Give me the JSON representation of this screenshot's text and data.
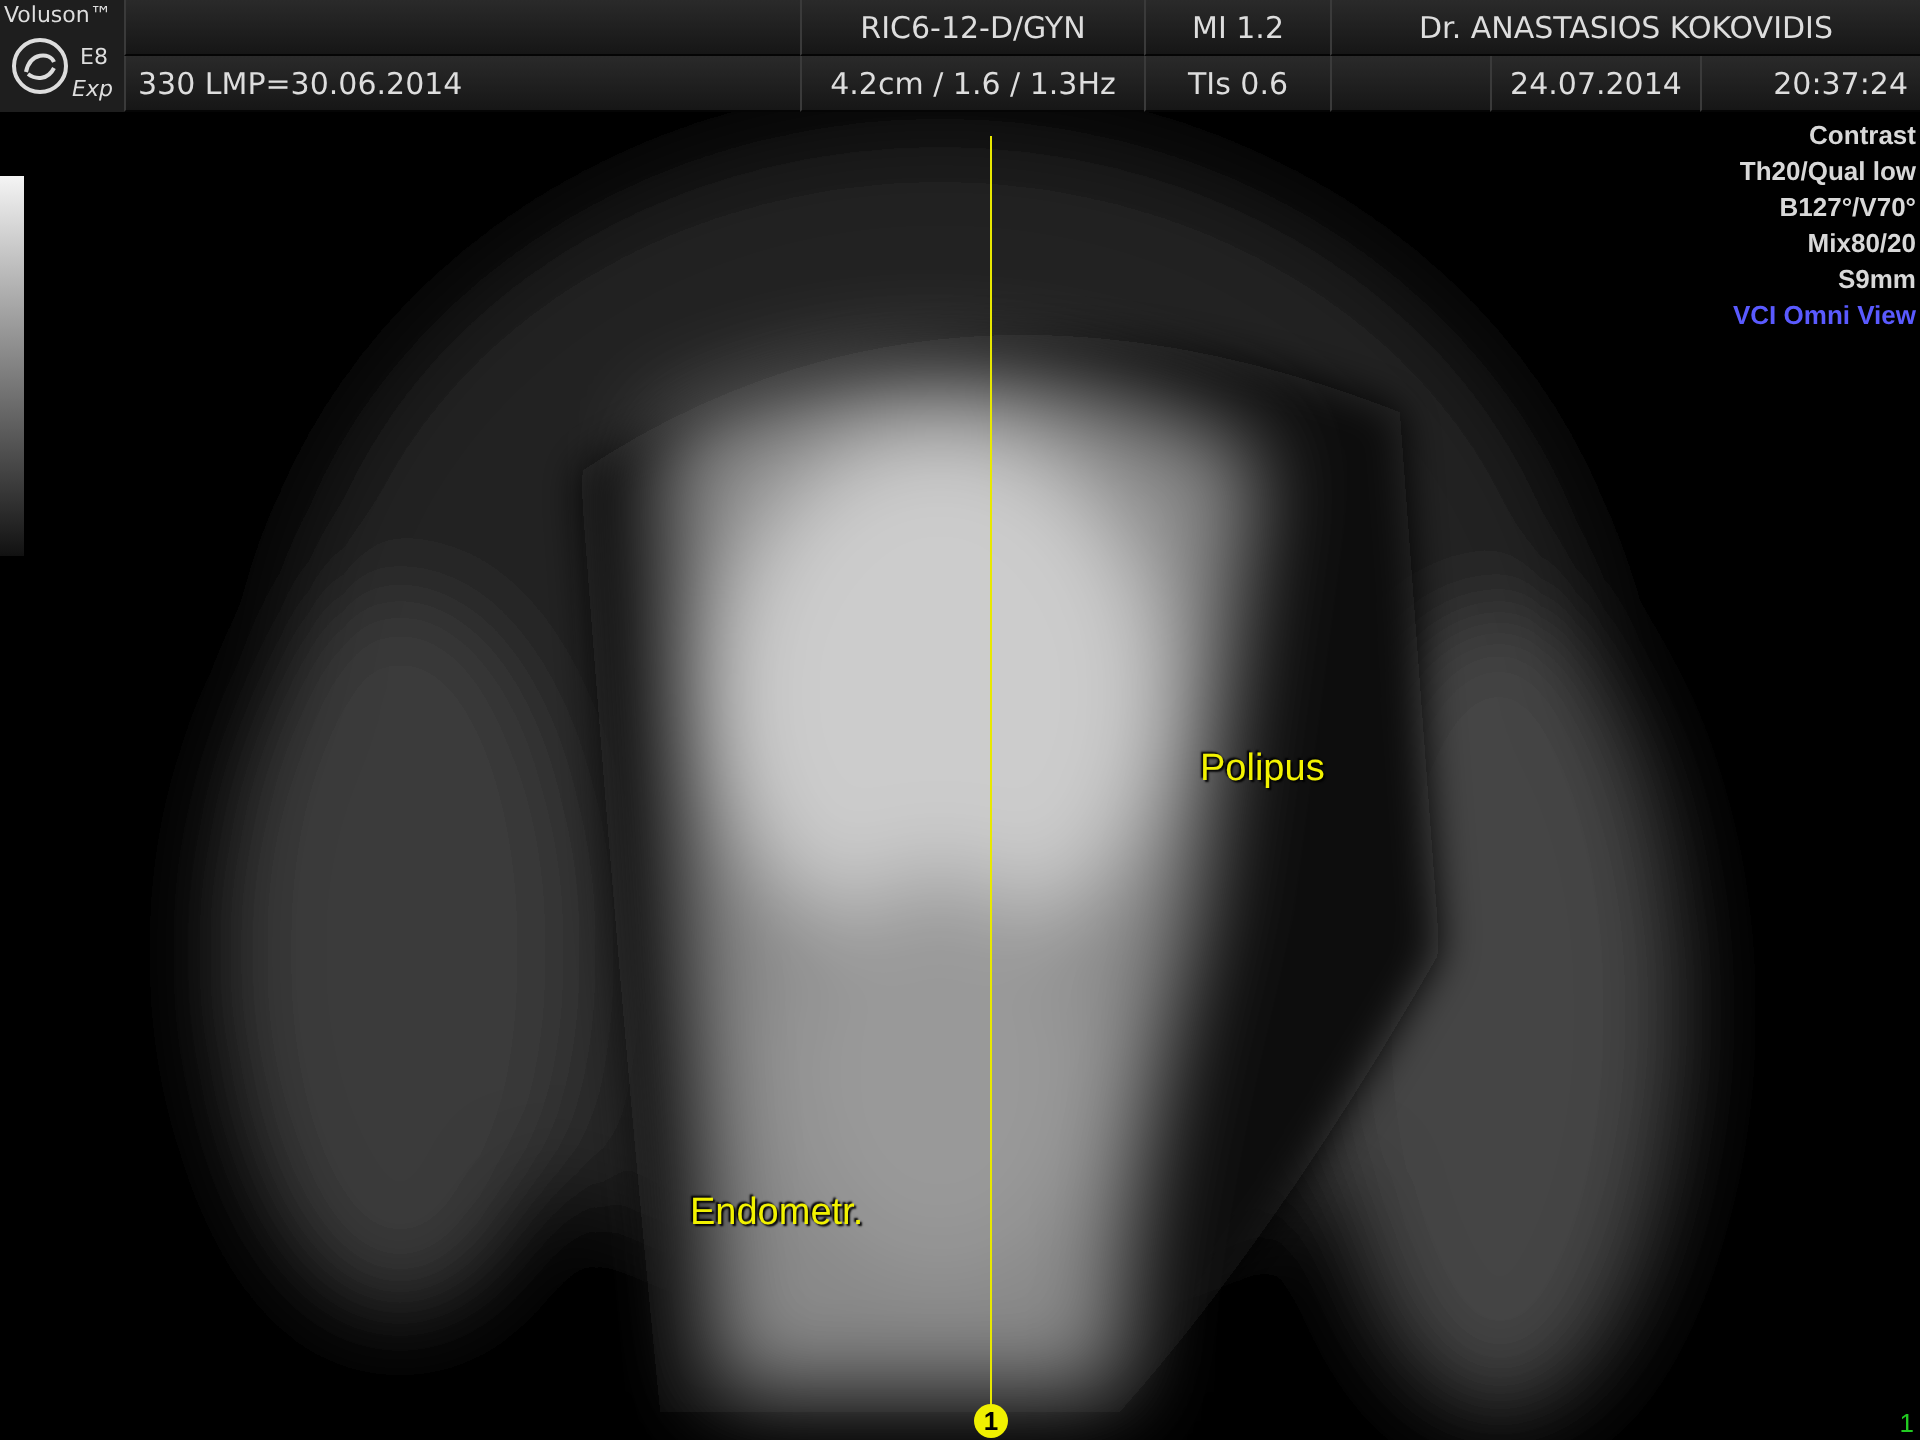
{
  "header": {
    "brand": "Voluson™",
    "model": "E8",
    "model_suffix": "Exp",
    "patient": "330  LMP=30.06.2014",
    "probe": "RIC6-12-D/GYN",
    "depth": "4.2cm / 1.6 / 1.3Hz",
    "mi": "MI  1.2",
    "tis": "TIs  0.6",
    "operator": "Dr. ANASTASIOS KOKOVIDIS",
    "date": "24.07.2014",
    "time": "20:37:24"
  },
  "settings": [
    {
      "text": "Contrast",
      "kind": "param"
    },
    {
      "text": "Th20/Qual low",
      "kind": "param"
    },
    {
      "text": "B127°/V70°",
      "kind": "param"
    },
    {
      "text": "Mix80/20",
      "kind": "param"
    },
    {
      "text": "S9mm",
      "kind": "param"
    },
    {
      "text": "VCI Omni View",
      "kind": "mode"
    }
  ],
  "annotations": [
    {
      "text": "Polipus"
    },
    {
      "text": "Endometr."
    }
  ],
  "cut_line": {
    "marker": "1"
  },
  "page_indicator": "1"
}
